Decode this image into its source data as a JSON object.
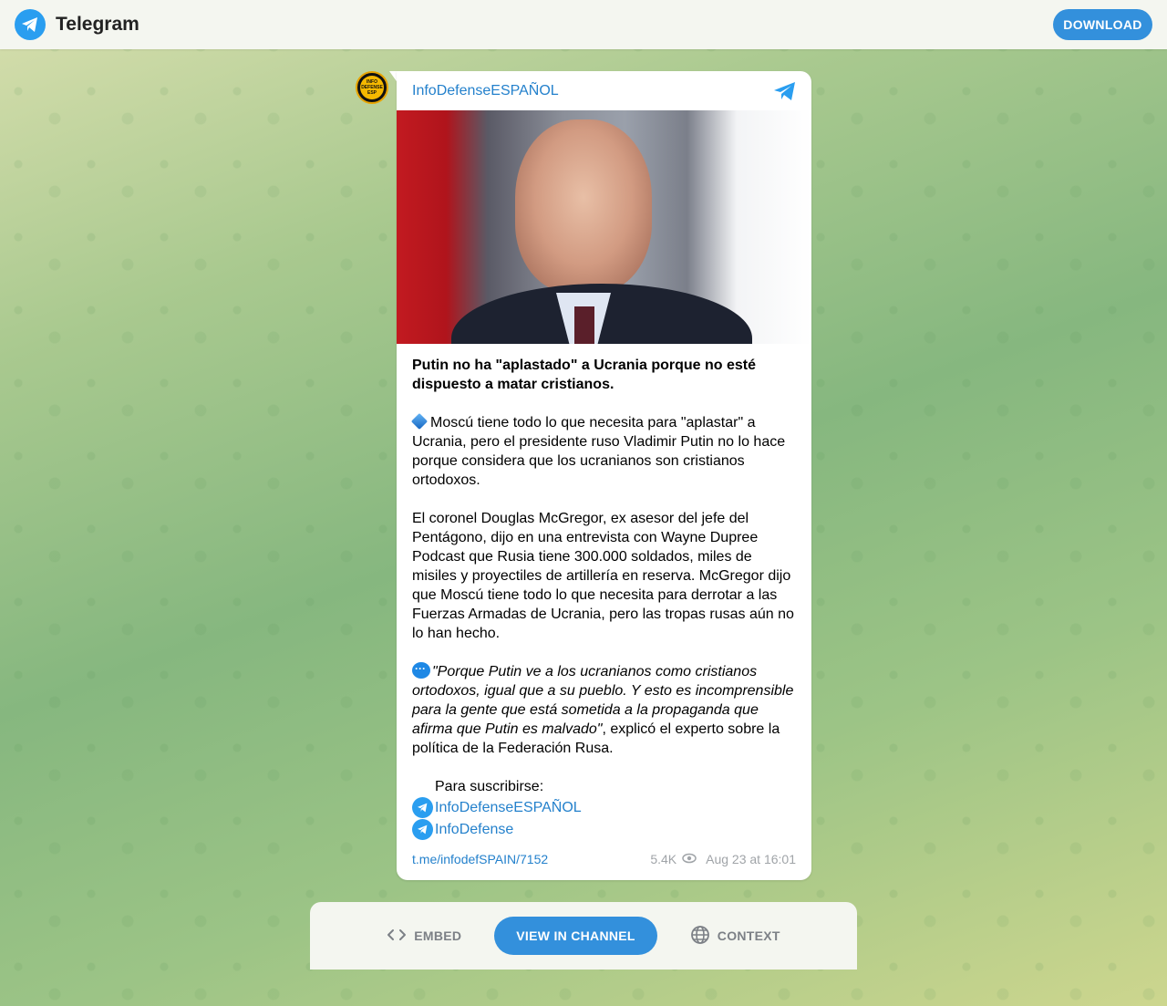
{
  "topbar": {
    "brand": "Telegram",
    "download_label": "DOWNLOAD",
    "logo_icon": "telegram-logo-icon"
  },
  "post": {
    "channel_name": "InfoDefenseESPAÑOL",
    "avatar_text": [
      "INFO",
      "DEFENSE",
      "ESP"
    ],
    "title": "Putin no ha \"aplastado\" a Ucrania porque no esté dispuesto a matar cristianos.",
    "para1": "Moscú tiene todo lo que necesita para \"aplastar\" a Ucrania, pero el presidente ruso Vladimir Putin no lo hace porque considera que los ucranianos son cristianos ortodoxos.",
    "para2": "El coronel Douglas McGregor, ex asesor del jefe del Pentágono, dijo en una entrevista con Wayne Dupree Podcast que Rusia tiene 300.000 soldados, miles de misiles y proyectiles de artillería en reserva. McGregor dijo que Moscú tiene todo lo que necesita para derrotar a las Fuerzas Armadas de Ucrania, pero las tropas rusas aún no lo han hecho.",
    "quote": "\"Porque Putin ve a los ucranianos como cristianos ortodoxos, igual que a su pueblo. Y esto es incomprensible para la gente que está sometida a la propaganda que afirma que Putin es malvado\"",
    "quote_tail": ", explicó el experto sobre la política de la Federación Rusa.",
    "subscribe_label": "Para suscribirse:",
    "links": [
      "InfoDefenseESPAÑOL",
      "InfoDefense"
    ],
    "permalink": "t.me/infodefSPAIN/7152",
    "views": "5.4K",
    "date": "Aug 23 at 16:01"
  },
  "bottom": {
    "embed_label": "EMBED",
    "view_label": "VIEW IN CHANNEL",
    "context_label": "CONTEXT"
  },
  "colors": {
    "accent": "#3390dc",
    "link": "#2481cc"
  }
}
